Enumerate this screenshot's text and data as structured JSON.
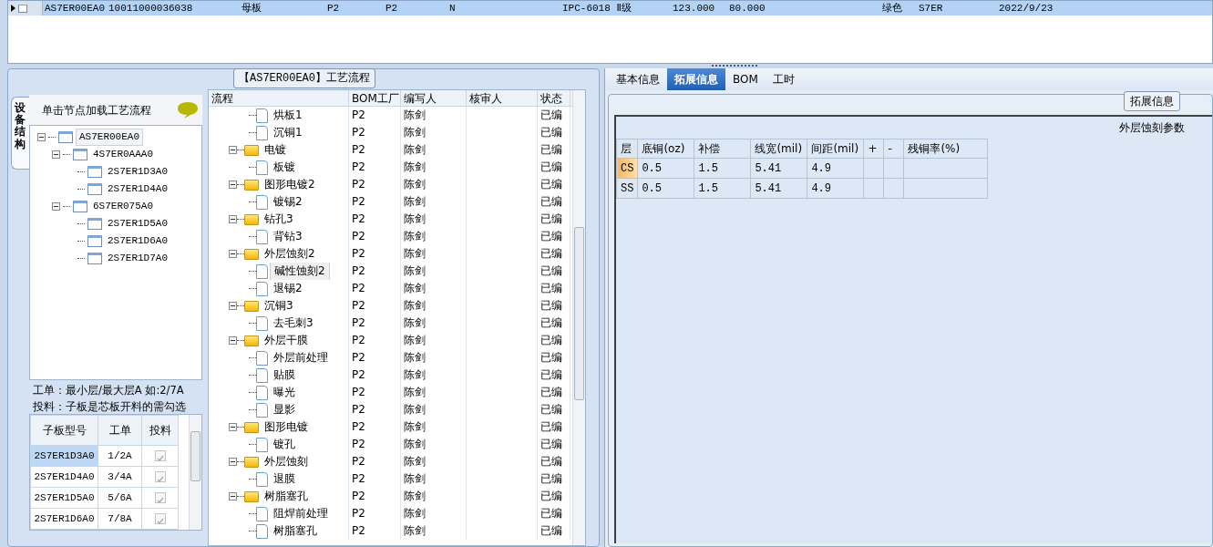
{
  "top_grid": {
    "rows": [
      {
        "selected": true,
        "cells": [
          "AS7ER00EA0",
          "10011000036038",
          "母板",
          "P2",
          "P2",
          "N",
          "IPC-6018 Ⅱ级",
          "123.000",
          "80.000",
          "绿色",
          "S7ER",
          "2022/9/23"
        ]
      }
    ]
  },
  "flow_group": {
    "title": "【AS7ER00EA0】工艺流程"
  },
  "side_tab": {
    "label": "设备结构",
    "selected": true
  },
  "structure": {
    "header": "单击节点加载工艺流程",
    "tree": [
      {
        "label": "AS7ER00EA0",
        "selected": true,
        "expanded": true,
        "children": [
          {
            "label": "4S7ER0AAA0",
            "selected": false,
            "expanded": true,
            "children": [
              {
                "label": "2S7ER1D3A0",
                "selected": false
              },
              {
                "label": "2S7ER1D4A0",
                "selected": false
              }
            ]
          },
          {
            "label": "6S7ER075A0",
            "selected": false,
            "expanded": true,
            "children": [
              {
                "label": "2S7ER1D5A0",
                "selected": false
              },
              {
                "label": "2S7ER1D6A0",
                "selected": false
              },
              {
                "label": "2S7ER1D7A0",
                "selected": false
              }
            ]
          }
        ]
      }
    ],
    "notes": [
      "工单：最小层/最大层A 如:2/7A",
      "投料：子板是芯板开料的需勾选"
    ],
    "sub_table": {
      "columns": [
        "子板型号",
        "工单",
        "投料"
      ],
      "rows": [
        {
          "model": "2S7ER1D3A0",
          "order": "1/2A",
          "feed": true,
          "selected": true
        },
        {
          "model": "2S7ER1D4A0",
          "order": "3/4A",
          "feed": true,
          "selected": false
        },
        {
          "model": "2S7ER1D5A0",
          "order": "5/6A",
          "feed": true,
          "selected": false
        },
        {
          "model": "2S7ER1D6A0",
          "order": "7/8A",
          "feed": true,
          "selected": false
        }
      ]
    }
  },
  "process": {
    "columns": [
      "流程",
      "BOM工厂",
      "编写人",
      "核审人",
      "状态"
    ],
    "rows": [
      {
        "kind": "step",
        "name": "烘板1",
        "factory": "P2",
        "writer": "陈剑",
        "status": "已编",
        "selected": false
      },
      {
        "kind": "step",
        "name": "沉铜1",
        "factory": "P2",
        "writer": "陈剑",
        "status": "已编",
        "selected": false
      },
      {
        "kind": "group",
        "name": "电镀",
        "factory": "P2",
        "writer": "陈剑",
        "status": "已编",
        "selected": false,
        "expanded": true,
        "children": [
          {
            "kind": "step",
            "name": "板镀",
            "factory": "P2",
            "writer": "陈剑",
            "status": "已编",
            "selected": false
          }
        ]
      },
      {
        "kind": "group",
        "name": "图形电镀2",
        "factory": "P2",
        "writer": "陈剑",
        "status": "已编",
        "selected": false,
        "expanded": true,
        "children": [
          {
            "kind": "step",
            "name": "镀锡2",
            "factory": "P2",
            "writer": "陈剑",
            "status": "已编",
            "selected": false
          }
        ]
      },
      {
        "kind": "group",
        "name": "钻孔3",
        "factory": "P2",
        "writer": "陈剑",
        "status": "已编",
        "selected": false,
        "expanded": true,
        "children": [
          {
            "kind": "step",
            "name": "背钻3",
            "factory": "P2",
            "writer": "陈剑",
            "status": "已编",
            "selected": false
          }
        ]
      },
      {
        "kind": "group",
        "name": "外层蚀刻2",
        "factory": "P2",
        "writer": "陈剑",
        "status": "已编",
        "selected": false,
        "expanded": true,
        "children": [
          {
            "kind": "step",
            "name": "碱性蚀刻2",
            "factory": "P2",
            "writer": "陈剑",
            "status": "已编",
            "selected": true
          },
          {
            "kind": "step",
            "name": "退锡2",
            "factory": "P2",
            "writer": "陈剑",
            "status": "已编",
            "selected": false
          }
        ]
      },
      {
        "kind": "group",
        "name": "沉铜3",
        "factory": "P2",
        "writer": "陈剑",
        "status": "已编",
        "selected": false,
        "expanded": true,
        "children": [
          {
            "kind": "step",
            "name": "去毛刺3",
            "factory": "P2",
            "writer": "陈剑",
            "status": "已编",
            "selected": false
          }
        ]
      },
      {
        "kind": "group",
        "name": "外层干膜",
        "factory": "P2",
        "writer": "陈剑",
        "status": "已编",
        "selected": false,
        "expanded": true,
        "children": [
          {
            "kind": "step",
            "name": "外层前处理",
            "factory": "P2",
            "writer": "陈剑",
            "status": "已编",
            "selected": false
          },
          {
            "kind": "step",
            "name": "贴膜",
            "factory": "P2",
            "writer": "陈剑",
            "status": "已编",
            "selected": false
          },
          {
            "kind": "step",
            "name": "曝光",
            "factory": "P2",
            "writer": "陈剑",
            "status": "已编",
            "selected": false
          },
          {
            "kind": "step",
            "name": "显影",
            "factory": "P2",
            "writer": "陈剑",
            "status": "已编",
            "selected": false
          }
        ]
      },
      {
        "kind": "group",
        "name": "图形电镀",
        "factory": "P2",
        "writer": "陈剑",
        "status": "已编",
        "selected": false,
        "expanded": true,
        "children": [
          {
            "kind": "step",
            "name": "镀孔",
            "factory": "P2",
            "writer": "陈剑",
            "status": "已编",
            "selected": false
          }
        ]
      },
      {
        "kind": "group",
        "name": "外层蚀刻",
        "factory": "P2",
        "writer": "陈剑",
        "status": "已编",
        "selected": false,
        "expanded": true,
        "children": [
          {
            "kind": "step",
            "name": "退膜",
            "factory": "P2",
            "writer": "陈剑",
            "status": "已编",
            "selected": false
          }
        ]
      },
      {
        "kind": "group",
        "name": "树脂塞孔",
        "factory": "P2",
        "writer": "陈剑",
        "status": "已编",
        "selected": false,
        "expanded": true,
        "children": [
          {
            "kind": "step",
            "name": "阻焊前处理",
            "factory": "P2",
            "writer": "陈剑",
            "status": "已编",
            "selected": false
          },
          {
            "kind": "step",
            "name": "树脂塞孔",
            "factory": "P2",
            "writer": "陈剑",
            "status": "已编",
            "selected": false
          }
        ]
      }
    ]
  },
  "detail_tabs": [
    {
      "label": "基本信息",
      "selected": false
    },
    {
      "label": "拓展信息",
      "selected": true
    },
    {
      "label": "BOM",
      "selected": false
    },
    {
      "label": "工时",
      "selected": false
    }
  ],
  "extension": {
    "group_title": "拓展信息",
    "section_title": "外层蚀刻参数",
    "columns": [
      "层",
      "底铜(oz)",
      "补偿",
      "线宽(mil)",
      "间距(mil)",
      "+",
      "-",
      "残铜率(%)"
    ],
    "rows": [
      {
        "selected": true,
        "cells": [
          "CS",
          "0.5",
          "1.5",
          "5.41",
          "4.9"
        ]
      },
      {
        "selected": false,
        "cells": [
          "SS",
          "0.5",
          "1.5",
          "5.41",
          "4.9"
        ]
      }
    ]
  }
}
